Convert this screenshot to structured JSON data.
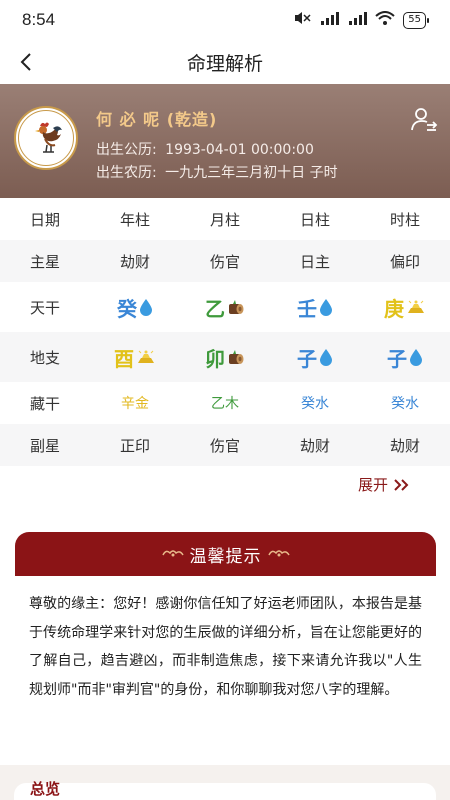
{
  "status_bar": {
    "time": "8:54",
    "battery": "55"
  },
  "nav": {
    "title": "命理解析"
  },
  "profile": {
    "name": "何 必 呢  (乾造)",
    "solar_label": "出生公历:",
    "solar_value": "1993-04-01 00:00:00",
    "lunar_label": "出生农历:",
    "lunar_value": "一九九三年三月初十日 子时"
  },
  "chart": {
    "headers": [
      "日期",
      "年柱",
      "月柱",
      "日柱",
      "时柱"
    ],
    "main_star": {
      "label": "主星",
      "values": [
        "劫财",
        "伤官",
        "日主",
        "偏印"
      ]
    },
    "heavenly_stems": {
      "label": "天干",
      "values": [
        {
          "char": "癸",
          "element": "water"
        },
        {
          "char": "乙",
          "element": "wood"
        },
        {
          "char": "壬",
          "element": "water"
        },
        {
          "char": "庚",
          "element": "metal"
        }
      ]
    },
    "earthly_branches": {
      "label": "地支",
      "values": [
        {
          "char": "酉",
          "element": "metal"
        },
        {
          "char": "卯",
          "element": "wood"
        },
        {
          "char": "子",
          "element": "water"
        },
        {
          "char": "子",
          "element": "water"
        }
      ]
    },
    "hidden_stems": {
      "label": "藏干",
      "values": [
        {
          "text": "辛金",
          "element": "metal"
        },
        {
          "text": "乙木",
          "element": "wood"
        },
        {
          "text": "癸水",
          "element": "water"
        },
        {
          "text": "癸水",
          "element": "water"
        }
      ]
    },
    "sub_star": {
      "label": "副星",
      "values": [
        "正印",
        "伤官",
        "劫财",
        "劫财"
      ]
    }
  },
  "expand_label": "展开",
  "tip": {
    "title": "温馨提示",
    "body": "尊敬的缘主：您好！感谢你信任知了好运老师团队，本报告是基于传统命理学来针对您的生辰做的详细分析，旨在让您能更好的了解自己，趋吉避凶，而非制造焦虑，接下来请允许我以\"人生规划师\"而非\"审判官\"的身份，和你聊聊我对您八字的理解。"
  },
  "colors": {
    "accent": "#8b1416",
    "profile_bg": "#8a6c61",
    "water": "#3a86d6",
    "wood": "#3f9a3c",
    "metal": "#e2c21a"
  },
  "bottom_section": {
    "label": "总览"
  }
}
